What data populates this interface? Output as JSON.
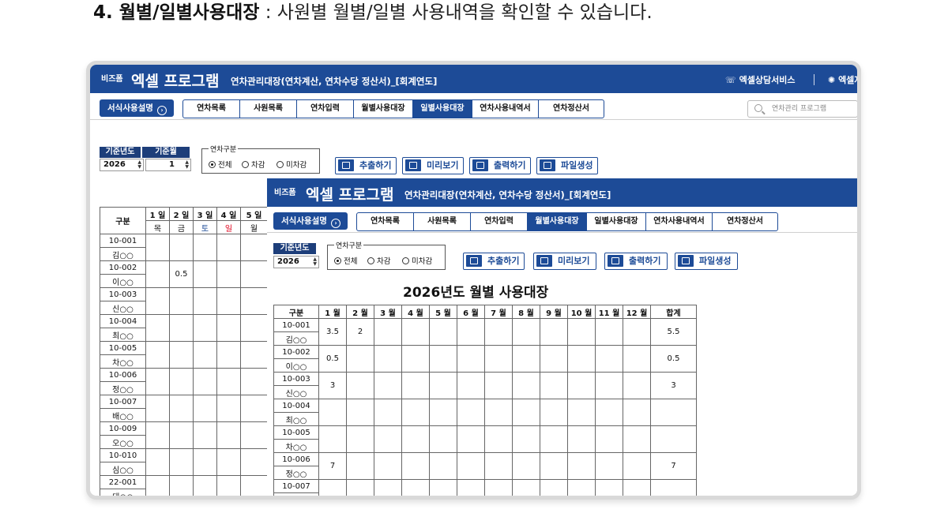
{
  "heading": {
    "bold": "4. 월별/일별사용대장",
    "rest": " : 사원별 월별/일별 사용내역을 확인할 수 있습니다."
  },
  "app": {
    "brand_small": "비즈폼",
    "brand_big": "엑셀 프로그램",
    "subtitle": "연차관리대장(연차계산, 연차수당 정산서)_[회계연도]",
    "consult": "엑셀상담서비스",
    "consult2": "엑셀져",
    "guide": "서식사용설명",
    "tabs": [
      "연차목록",
      "사원목록",
      "연차입력",
      "월별사용대장",
      "일별사용대장",
      "연차사용내역서",
      "연차정산서"
    ],
    "search_placeholder": "연차관리 프로그램",
    "colors": {
      "primary": "#1d4b97",
      "header": "#1d3e7a",
      "red": "#e0001b"
    }
  },
  "back": {
    "year_label": "기준년도",
    "month_label": "기준월",
    "year": "2026",
    "month": "1",
    "group_label": "연차구분",
    "radios": [
      "전체",
      "차감",
      "미차감"
    ],
    "actions": [
      "추출하기",
      "미리보기",
      "출력하기",
      "파일생성"
    ],
    "col_label": "구분",
    "days": [
      "1 일",
      "2 일",
      "3 일",
      "4 일",
      "5 일"
    ],
    "weekdays": [
      "목",
      "금",
      "토",
      "일",
      "월"
    ],
    "rows": [
      {
        "id": "10-001",
        "name": "김○○",
        "d": [
          "",
          "",
          "",
          "",
          ""
        ]
      },
      {
        "id": "10-002",
        "name": "이○○",
        "d": [
          "",
          "0.5",
          "",
          "",
          ""
        ]
      },
      {
        "id": "10-003",
        "name": "신○○",
        "d": [
          "",
          "",
          "",
          "",
          ""
        ]
      },
      {
        "id": "10-004",
        "name": "최○○",
        "d": [
          "",
          "",
          "",
          "",
          ""
        ]
      },
      {
        "id": "10-005",
        "name": "차○○",
        "d": [
          "",
          "",
          "",
          "",
          ""
        ]
      },
      {
        "id": "10-006",
        "name": "정○○",
        "d": [
          "",
          "",
          "",
          "",
          ""
        ]
      },
      {
        "id": "10-007",
        "name": "배○○",
        "d": [
          "",
          "",
          "",
          "",
          ""
        ]
      },
      {
        "id": "10-009",
        "name": "오○○",
        "d": [
          "",
          "",
          "",
          "",
          ""
        ]
      },
      {
        "id": "10-010",
        "name": "심○○",
        "d": [
          "",
          "",
          "",
          "",
          ""
        ]
      },
      {
        "id": "22-001",
        "name": "태○○",
        "d": [
          "",
          "",
          "",
          "",
          ""
        ]
      }
    ]
  },
  "front": {
    "year_label": "기준년도",
    "year": "2026",
    "group_label": "연차구분",
    "radios": [
      "전체",
      "차감",
      "미차감"
    ],
    "actions": [
      "추출하기",
      "미리보기",
      "출력하기",
      "파일생성"
    ],
    "title": "2026년도 월별 사용대장",
    "col_label": "구분",
    "months": [
      "1 월",
      "2 월",
      "3 월",
      "4 월",
      "5 월",
      "6 월",
      "7 월",
      "8 월",
      "9 월",
      "10 월",
      "11 월",
      "12 월"
    ],
    "total_label": "합계",
    "rows": [
      {
        "id": "10-001",
        "name": "김○○",
        "m": [
          "3.5",
          "2",
          "",
          "",
          "",
          "",
          "",
          "",
          "",
          "",
          "",
          ""
        ],
        "total": "5.5"
      },
      {
        "id": "10-002",
        "name": "이○○",
        "m": [
          "0.5",
          "",
          "",
          "",
          "",
          "",
          "",
          "",
          "",
          "",
          "",
          ""
        ],
        "total": "0.5"
      },
      {
        "id": "10-003",
        "name": "신○○",
        "m": [
          "3",
          "",
          "",
          "",
          "",
          "",
          "",
          "",
          "",
          "",
          "",
          ""
        ],
        "total": "3"
      },
      {
        "id": "10-004",
        "name": "최○○",
        "m": [
          "",
          "",
          "",
          "",
          "",
          "",
          "",
          "",
          "",
          "",
          "",
          ""
        ],
        "total": ""
      },
      {
        "id": "10-005",
        "name": "차○○",
        "m": [
          "",
          "",
          "",
          "",
          "",
          "",
          "",
          "",
          "",
          "",
          "",
          ""
        ],
        "total": ""
      },
      {
        "id": "10-006",
        "name": "정○○",
        "m": [
          "7",
          "",
          "",
          "",
          "",
          "",
          "",
          "",
          "",
          "",
          "",
          ""
        ],
        "total": "7"
      },
      {
        "id": "10-007",
        "name": "",
        "m": [
          "",
          "",
          "",
          "",
          "",
          "",
          "",
          "",
          "",
          "",
          "",
          ""
        ],
        "total": ""
      }
    ]
  }
}
